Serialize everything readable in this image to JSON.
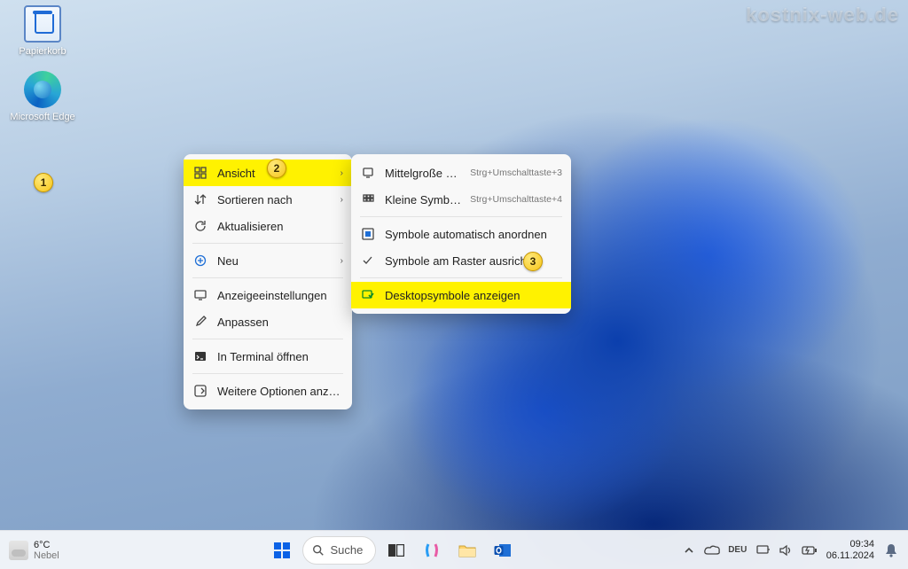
{
  "watermark": "kostnix-web.de",
  "desktop_icons": {
    "recycle_bin": "Papierkorb",
    "edge": "Microsoft Edge"
  },
  "annotations": {
    "a1": "1",
    "a2": "2",
    "a3": "3"
  },
  "context_menu": {
    "items": [
      {
        "label": "Ansicht",
        "icon": "grid",
        "arrow": true,
        "highlight": true
      },
      {
        "label": "Sortieren nach",
        "icon": "sort",
        "arrow": true
      },
      {
        "label": "Aktualisieren",
        "icon": "refresh"
      },
      {
        "sep": true
      },
      {
        "label": "Neu",
        "icon": "plus",
        "arrow": true
      },
      {
        "sep": true
      },
      {
        "label": "Anzeigeeinstellungen",
        "icon": "display"
      },
      {
        "label": "Anpassen",
        "icon": "brush"
      },
      {
        "sep": true
      },
      {
        "label": "In Terminal öffnen",
        "icon": "terminal"
      },
      {
        "sep": true
      },
      {
        "label": "Weitere Optionen anzeigen",
        "icon": "more"
      }
    ]
  },
  "submenu": {
    "items": [
      {
        "label": "Mittelgroße Symbole",
        "icon": "monitor",
        "shortcut": "Strg+Umschalttaste+3"
      },
      {
        "label": "Kleine Symbole",
        "icon": "grid-sm",
        "shortcut": "Strg+Umschalttaste+4"
      },
      {
        "sep": true
      },
      {
        "label": "Symbole automatisch anordnen",
        "icon": "arrange"
      },
      {
        "label": "Symbole am Raster ausrichten",
        "icon": "check"
      },
      {
        "sep": true
      },
      {
        "label": "Desktopsymbole anzeigen",
        "icon": "desktop-chk",
        "highlight": true
      }
    ]
  },
  "taskbar": {
    "weather_temp": "6°C",
    "weather_desc": "Nebel",
    "search_placeholder": "Suche",
    "clock_time": "09:34",
    "clock_date": "06.11.2024"
  }
}
